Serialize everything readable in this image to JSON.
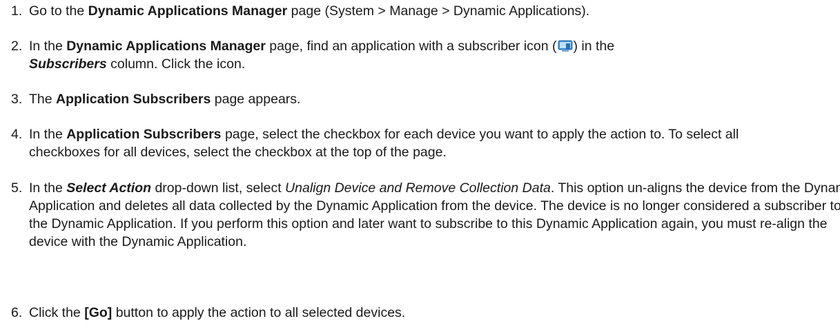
{
  "steps": [
    {
      "number": "1.",
      "parts": [
        "Go to the ",
        "Dynamic Applications Manager",
        " page (System > Manage > Dynamic Applications)."
      ]
    },
    {
      "number": "2.",
      "parts": [
        "In the ",
        "Dynamic Applications Manager",
        " page, find an application with a subscriber icon (",
        ") in the ",
        "Subscribers",
        " column. Click the icon."
      ],
      "icon": "subscriber-icon"
    },
    {
      "number": "3.",
      "parts": [
        "The ",
        "Application Subscribers",
        " page appears."
      ]
    },
    {
      "number": "4.",
      "parts": [
        "In the ",
        "Application Subscribers",
        " page, select the checkbox for each device you want to apply the action to. To select all checkboxes for all devices, select the checkbox at the top of the page."
      ]
    },
    {
      "number": "5.",
      "parts": [
        "In the ",
        "Select Action",
        " drop-down list, select ",
        "Unalign Device and Remove Collection Data",
        ". This option un-aligns the device from the Dynamic Application and deletes all data collected by the Dynamic Application from the device. The device is no longer considered a subscriber to the Dynamic Application. If you perform this option and later want to subscribe to this Dynamic Application again, you must re-align the device with the Dynamic Application."
      ]
    },
    {
      "number": "6.",
      "parts": [
        "Click the ",
        "[Go]",
        " button to apply the action to all selected devices."
      ]
    }
  ]
}
